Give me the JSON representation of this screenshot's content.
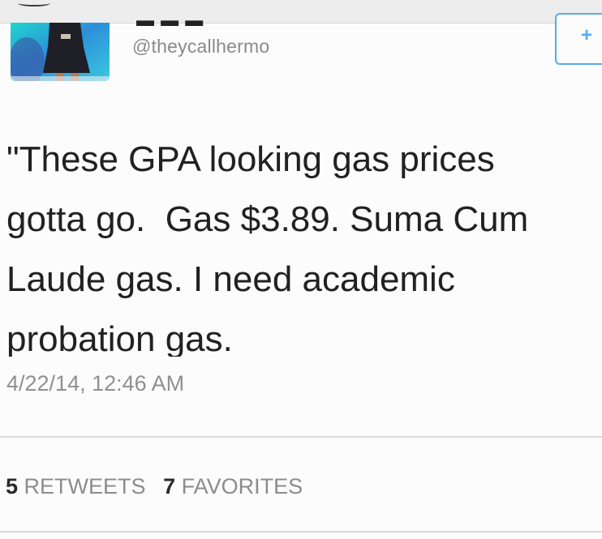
{
  "tweet": {
    "handle": "@theycallhermo",
    "text": "\"These GPA looking gas prices\ngotta go.  Gas $3.89. Suma Cum\nLaude gas. I need academic\nprobation gas.",
    "timestamp": "4/22/14, 12:46 AM"
  },
  "stats": {
    "retweets_count": "5",
    "retweets_label": "RETWEETS",
    "favorites_count": "7",
    "favorites_label": "FAVORITES"
  },
  "colors": {
    "accent": "#55acee",
    "text": "#212121",
    "muted": "#8c8c8c"
  },
  "icons": {
    "follow": "follow-plus-icon"
  }
}
